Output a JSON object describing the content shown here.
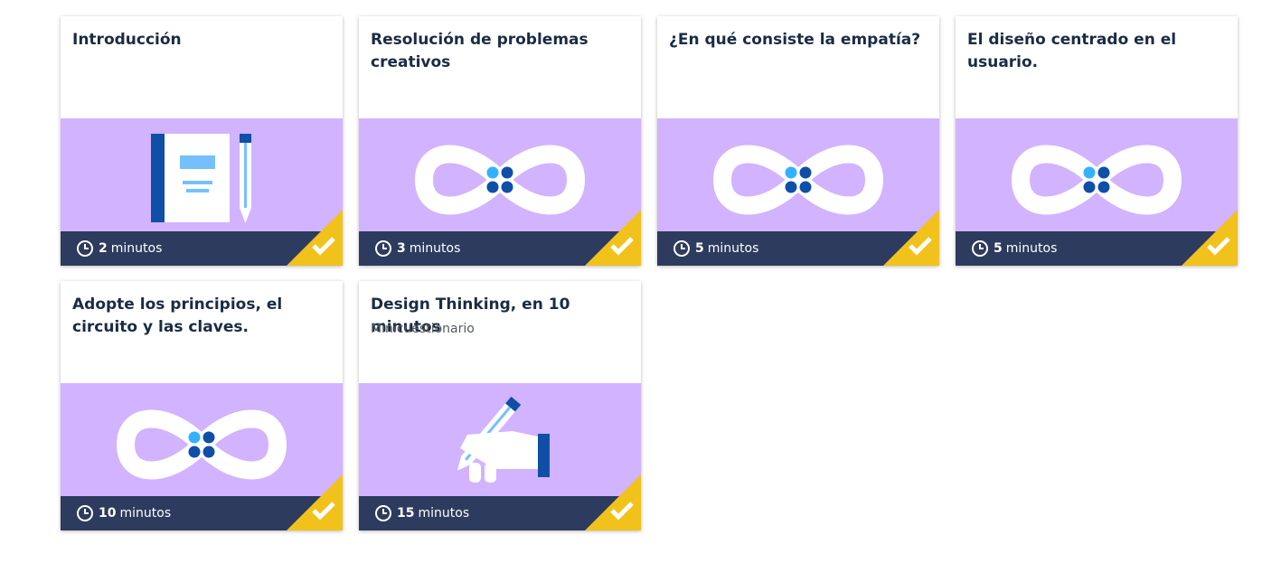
{
  "cards": [
    {
      "title": "Introducción",
      "subtitle": "",
      "duration_value": "2",
      "duration_unit": "minutos",
      "illustration": "notebook-pencil-icon",
      "completed": true
    },
    {
      "title": "Resolución de problemas creativos",
      "subtitle": "",
      "duration_value": "3",
      "duration_unit": "minutos",
      "illustration": "infinity-loop-icon",
      "completed": true
    },
    {
      "title": "¿En qué consiste la empatía?",
      "subtitle": "",
      "duration_value": "5",
      "duration_unit": "minutos",
      "illustration": "infinity-loop-icon",
      "completed": true
    },
    {
      "title": "El diseño centrado en el usuario.",
      "subtitle": "",
      "duration_value": "5",
      "duration_unit": "minutos",
      "illustration": "infinity-loop-icon",
      "completed": true
    },
    {
      "title": "Adopte los principios, el circuito y las claves.",
      "subtitle": "",
      "duration_value": "10",
      "duration_unit": "minutos",
      "illustration": "infinity-loop-icon",
      "completed": true
    },
    {
      "title": "Design Thinking, en 10 minutos",
      "subtitle": "Minicuestionario",
      "duration_value": "15",
      "duration_unit": "minutos",
      "illustration": "hand-writing-icon",
      "completed": true
    }
  ],
  "colors": {
    "art_background": "#d1b3ff",
    "footer_background": "#2d3b5e",
    "completed_corner": "#f1c21b",
    "title_text": "#1a2c44",
    "accent_blue": "#0f62fe",
    "dark_blue": "#0043ce",
    "light_blue": "#33b1ff"
  }
}
